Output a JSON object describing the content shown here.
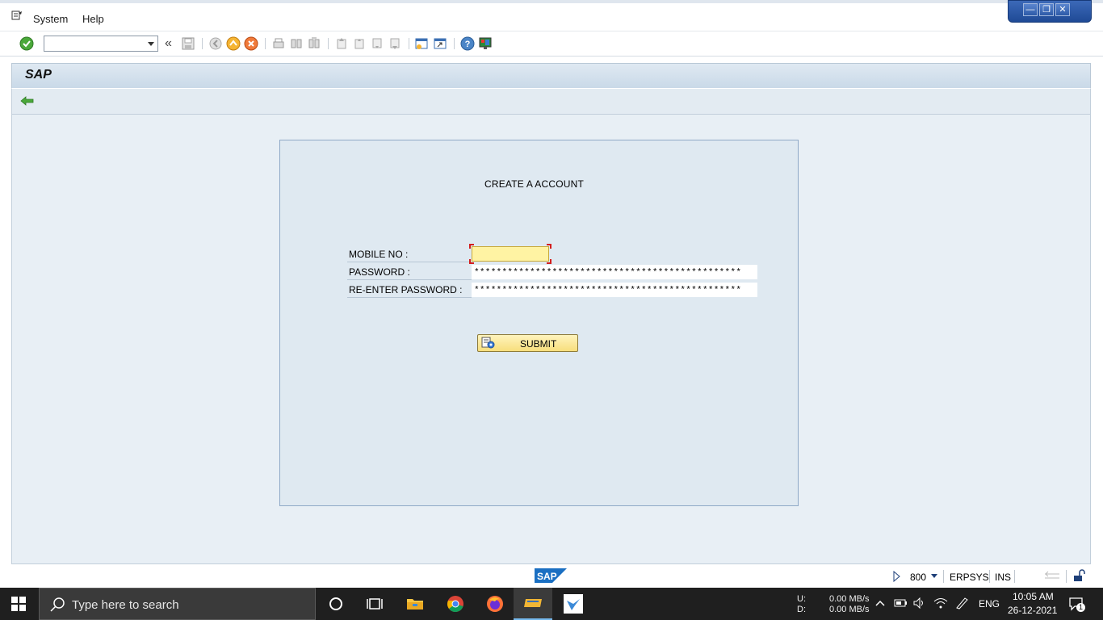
{
  "menu": {
    "system_label": "System",
    "help_label": "Help"
  },
  "toolbar": {
    "command_field_value": "",
    "chevron": "«"
  },
  "screen": {
    "title": "SAP"
  },
  "form": {
    "heading": "CREATE A ACCOUNT",
    "mobile_label": "MOBILE NO :",
    "mobile_value": "",
    "password_label": "PASSWORD :",
    "password_value": "************************************************",
    "repassword_label": "RE-ENTER PASSWORD :",
    "repassword_value": "************************************************",
    "submit_label": "SUBMIT"
  },
  "status": {
    "client": "800",
    "system": "ERPSYS",
    "mode": "INS",
    "logo_text": "SAP"
  },
  "taskbar": {
    "search_placeholder": "Type here to search",
    "net_up_label": "U:",
    "net_down_label": "D:",
    "net_up_value": "0.00 MB/s",
    "net_down_value": "0.00 MB/s",
    "language": "ENG",
    "time": "10:05 AM",
    "date": "26-12-2021",
    "notification_count": "1"
  },
  "colors": {
    "accent_yellow": "#f7de7c",
    "panel_blue": "#dfe9f1",
    "taskbar": "#1f1f1f"
  }
}
